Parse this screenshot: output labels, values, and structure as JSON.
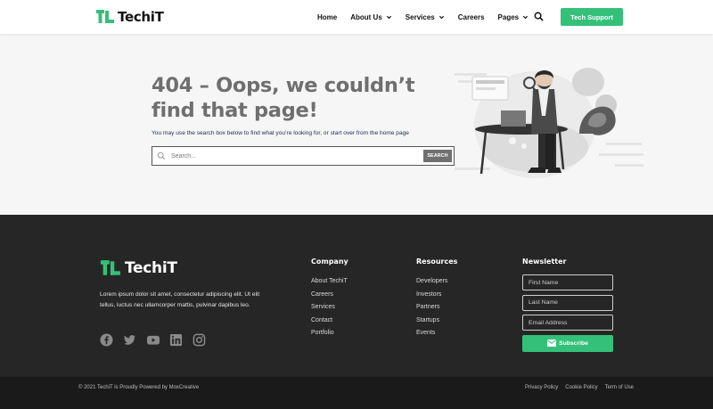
{
  "header": {
    "logo_text": "TechiT",
    "nav": [
      {
        "label": "Home",
        "has_dropdown": false
      },
      {
        "label": "About Us",
        "has_dropdown": true
      },
      {
        "label": "Services",
        "has_dropdown": true
      },
      {
        "label": "Careers",
        "has_dropdown": false
      },
      {
        "label": "Pages",
        "has_dropdown": true
      }
    ],
    "search_icon": "search-icon",
    "cta_label": "Tech Support"
  },
  "hero": {
    "title": "404 – Oops, we couldn’t find that page!",
    "subtitle": "You may use the search box below to find what you’re looking for, or start over from the home page",
    "search_placeholder": "Search...",
    "search_button": "SEARCH"
  },
  "footer": {
    "logo_text": "TechiT",
    "description": "Lorem ipsum dolor sit amet, consectetur adipiscing elit. Ut elit tellus, luctus nec ullamcorper mattis, pulvinar dapibus leo.",
    "socials": [
      "facebook-icon",
      "twitter-icon",
      "youtube-icon",
      "linkedin-icon",
      "instagram-icon"
    ],
    "company": {
      "heading": "Company",
      "links": [
        "About TechiT",
        "Careers",
        "Services",
        "Contact",
        "Portfolio"
      ]
    },
    "resources": {
      "heading": "Resources",
      "links": [
        "Developers",
        "Investors",
        "Partners",
        "Startups",
        "Events"
      ]
    },
    "newsletter": {
      "heading": "Newsletter",
      "first_name": "First Name",
      "last_name": "Last Name",
      "email": "Email Address",
      "subscribe": "Subscribe"
    },
    "copyright": "© 2021 TechiT is Proudly Powered by MoxCreative",
    "legal": [
      "Privacy Policy",
      "Cookie Policy",
      "Term of Use"
    ]
  },
  "colors": {
    "accent": "#35c07a",
    "footer_bg": "#262626",
    "bottom_bg": "#1a1a1a",
    "title_gray": "#6f6f6f"
  }
}
